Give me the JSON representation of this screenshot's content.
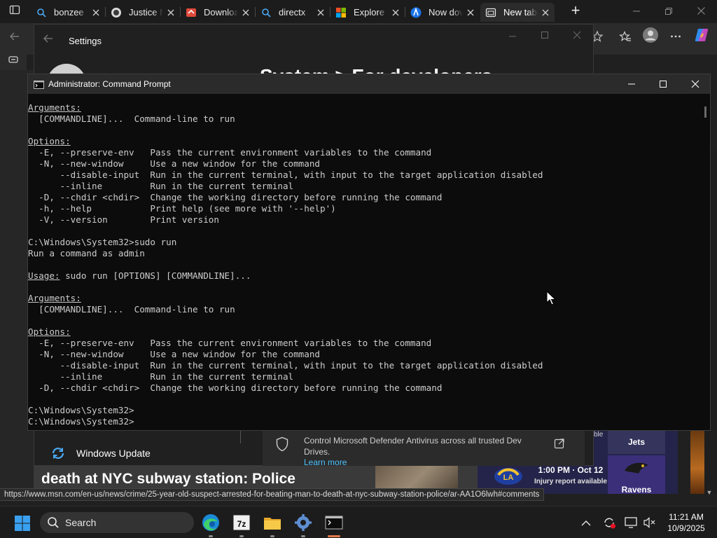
{
  "browser": {
    "tabs": [
      {
        "title": "bonzee",
        "icon": "search-icon",
        "active": false
      },
      {
        "title": "Justice M",
        "icon": "justice-site-icon",
        "active": false
      },
      {
        "title": "Downloa",
        "icon": "download-site-icon",
        "active": false
      },
      {
        "title": "directx",
        "icon": "search-icon",
        "active": false
      },
      {
        "title": "Explore",
        "icon": "microsoft-logo-icon",
        "active": false
      },
      {
        "title": "Now dow",
        "icon": "azure-site-icon",
        "active": false
      },
      {
        "title": "New tab",
        "icon": "new-tab-page-icon",
        "active": true
      }
    ],
    "status_url": "https://www.msn.com/en-us/news/crime/25-year-old-suspect-arrested-for-beating-man-to-death-at-nyc-subway-station-police/ar-AA1O6lwh#comments"
  },
  "msn": {
    "headline": "death at NYC subway station: Police",
    "sports": {
      "top_label": "ble",
      "team_top": "Jets",
      "game_time": "1:00 PM · Oct 12",
      "game_note": "Injury report available",
      "team_bottom": "Ravens"
    }
  },
  "settings": {
    "title": "Settings",
    "heading": "System  >  For developers",
    "nav_item": "Windows Update",
    "defender_text": "Control Microsoft Defender Antivirus across all trusted Dev Drives.",
    "defender_link": "Learn more"
  },
  "cmd": {
    "title": "Administrator: Command Prompt",
    "lines": [
      [
        {
          "t": "Arguments:",
          "u": true
        }
      ],
      [
        {
          "t": "  [COMMANDLINE]...  Command-line to run"
        }
      ],
      [
        {
          "t": ""
        }
      ],
      [
        {
          "t": "Options:",
          "u": true
        }
      ],
      [
        {
          "t": "  -E, --preserve-env   Pass the current environment variables to the command"
        }
      ],
      [
        {
          "t": "  -N, --new-window     Use a new window for the command"
        }
      ],
      [
        {
          "t": "      --disable-input  Run in the current terminal, with input to the target application disabled"
        }
      ],
      [
        {
          "t": "      --inline         Run in the current terminal"
        }
      ],
      [
        {
          "t": "  -D, --chdir <chdir>  Change the working directory before running the command"
        }
      ],
      [
        {
          "t": "  -h, --help           Print help (see more with '--help')"
        }
      ],
      [
        {
          "t": "  -V, --version        Print version"
        }
      ],
      [
        {
          "t": ""
        }
      ],
      [
        {
          "t": "C:\\Windows\\System32>sudo run"
        }
      ],
      [
        {
          "t": "Run a command as admin"
        }
      ],
      [
        {
          "t": ""
        }
      ],
      [
        {
          "t": "Usage:",
          "u": true
        },
        {
          "t": " sudo run [OPTIONS] [COMMANDLINE]..."
        }
      ],
      [
        {
          "t": ""
        }
      ],
      [
        {
          "t": "Arguments:",
          "u": true
        }
      ],
      [
        {
          "t": "  [COMMANDLINE]...  Command-line to run"
        }
      ],
      [
        {
          "t": ""
        }
      ],
      [
        {
          "t": "Options:",
          "u": true
        }
      ],
      [
        {
          "t": "  -E, --preserve-env   Pass the current environment variables to the command"
        }
      ],
      [
        {
          "t": "  -N, --new-window     Use a new window for the command"
        }
      ],
      [
        {
          "t": "      --disable-input  Run in the current terminal, with input to the target application disabled"
        }
      ],
      [
        {
          "t": "      --inline         Run in the current terminal"
        }
      ],
      [
        {
          "t": "  -D, --chdir <chdir>  Change the working directory before running the command"
        }
      ],
      [
        {
          "t": ""
        }
      ],
      [
        {
          "t": "C:\\Windows\\System32>"
        }
      ],
      [
        {
          "t": "C:\\Windows\\System32>"
        }
      ]
    ]
  },
  "taskbar": {
    "search_label": "Search",
    "apps": [
      "edge-icon",
      "7zip-icon",
      "file-explorer-icon",
      "settings-icon",
      "terminal-icon"
    ],
    "time": "11:21 AM",
    "date": "10/9/2025"
  },
  "colors": {
    "accent_link": "#4cc2ff",
    "cmd_bg": "#0c0c0c",
    "cmd_text": "#cccccc"
  }
}
